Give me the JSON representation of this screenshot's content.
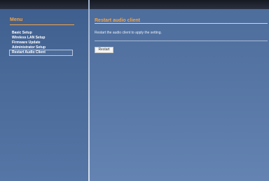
{
  "menu": {
    "title": "Menu",
    "items": [
      {
        "label": "Basic Setup"
      },
      {
        "label": "Wireless LAN Setup"
      },
      {
        "label": "Firmware Update"
      },
      {
        "label": "Administrator Setup"
      },
      {
        "label": "Restart Audio Client"
      }
    ],
    "active_index": 4
  },
  "main": {
    "title": "Restart audio client",
    "description": "Restart the audio client to apply the setting.",
    "restart_button": "Restart"
  },
  "colors": {
    "accent": "#f3a546",
    "panel_blue": "#4d6d9c",
    "top_bar": "#151922"
  }
}
